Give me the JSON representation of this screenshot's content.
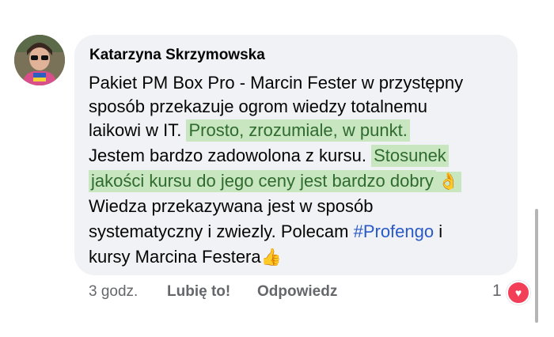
{
  "comment": {
    "author": "Katarzyna Skrzymowska",
    "lines": [
      [
        {
          "text": "Pakiet PM Box Pro - Marcin Fester w przystępny",
          "style": "plain"
        }
      ],
      [
        {
          "text": "sposób przekazuje ogrom wiedzy totalnemu",
          "style": "plain"
        }
      ],
      [
        {
          "text": "laikowi w IT. ",
          "style": "plain"
        },
        {
          "text": "Prosto, zrozumiale, w punkt.",
          "style": "highlight"
        }
      ],
      [
        {
          "text": "Jestem bardzo zadowolona z kursu. ",
          "style": "plain"
        },
        {
          "text": "Stosunek",
          "style": "highlight"
        }
      ],
      [
        {
          "text": "jakości kursu do jego ceny jest bardzo dobry",
          "style": "highlight"
        },
        {
          "text": "👌",
          "style": "emoji-hl"
        }
      ],
      [
        {
          "text": "Wiedza przekazywana jest w sposób",
          "style": "plain"
        }
      ],
      [
        {
          "text": "systematyczny i zwiezly.  Polecam ",
          "style": "plain"
        },
        {
          "text": "#Profengo",
          "style": "hashtag"
        },
        {
          "text": " i",
          "style": "plain"
        }
      ],
      [
        {
          "text": "kursy Marcina Festera",
          "style": "plain"
        },
        {
          "text": "👍",
          "style": "emoji"
        }
      ]
    ]
  },
  "actions": {
    "time": "3 godz.",
    "like_label": "Lubię to!",
    "reply_label": "Odpowiedz"
  },
  "reactions": {
    "count": "1",
    "icon": "heart-icon",
    "color": "#f33e58"
  },
  "colors": {
    "highlight_bg": "#c8e6c0",
    "highlight_text": "#2f6b2f",
    "hashtag": "#2a5ac7",
    "bubble": "#f0f2f5"
  }
}
